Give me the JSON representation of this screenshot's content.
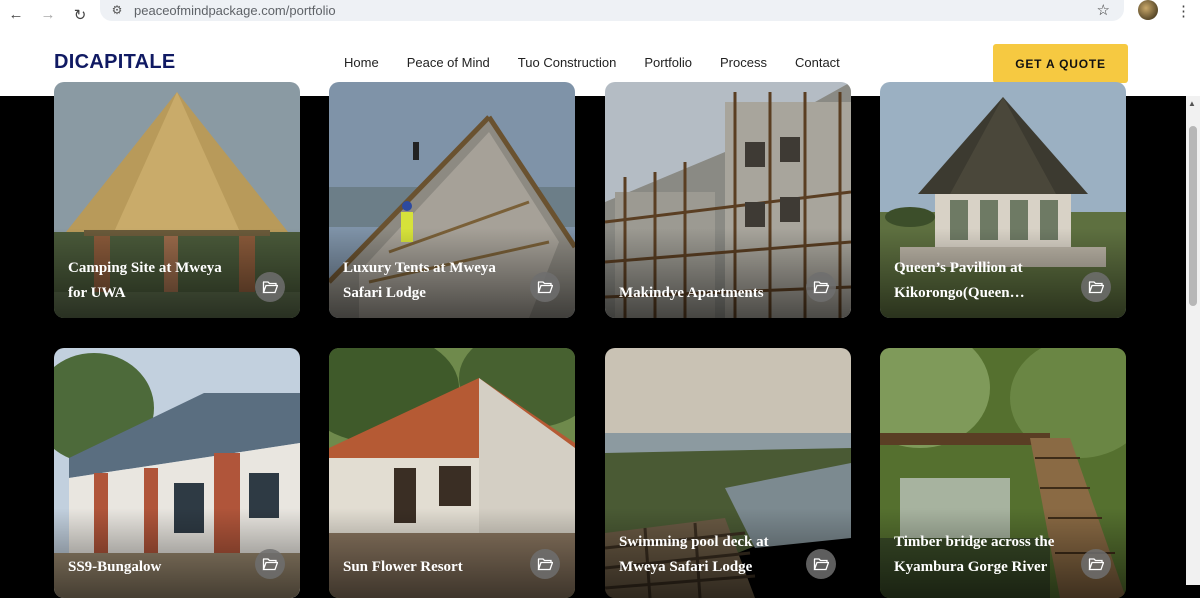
{
  "browser": {
    "url": "peaceofmindpackage.com/portfolio",
    "back_icon": "arrow-left-icon",
    "forward_icon": "arrow-right-icon",
    "reload_icon": "reload-icon",
    "bookmark_icon": "star-icon"
  },
  "header": {
    "logo": "DICAPITALE",
    "nav": [
      "Home",
      "Peace of Mind",
      "Tuo Construction",
      "Portfolio",
      "Process",
      "Contact"
    ],
    "cta": "GET A QUOTE",
    "colors": {
      "logo": "#101a63",
      "cta_bg": "#f6c941"
    }
  },
  "portfolio": {
    "items": [
      {
        "title_line1": "Camping Site at Mweya",
        "title_line2": "for UWA"
      },
      {
        "title_line1": "Luxury Tents at Mweya",
        "title_line2": "Safari Lodge"
      },
      {
        "title_line1": "Makindye Apartments",
        "title_line2": ""
      },
      {
        "title_line1": "Queen’s Pavillion at",
        "title_line2": "Kikorongo(Queen…"
      },
      {
        "title_line1": "SS9-Bungalow",
        "title_line2": ""
      },
      {
        "title_line1": "Sun Flower Resort",
        "title_line2": ""
      },
      {
        "title_line1": "Swimming pool deck at",
        "title_line2": "Mweya Safari Lodge"
      },
      {
        "title_line1": "Timber bridge across the",
        "title_line2": "Kyambura Gorge River"
      }
    ],
    "folder_icon": "folder-open-icon"
  }
}
